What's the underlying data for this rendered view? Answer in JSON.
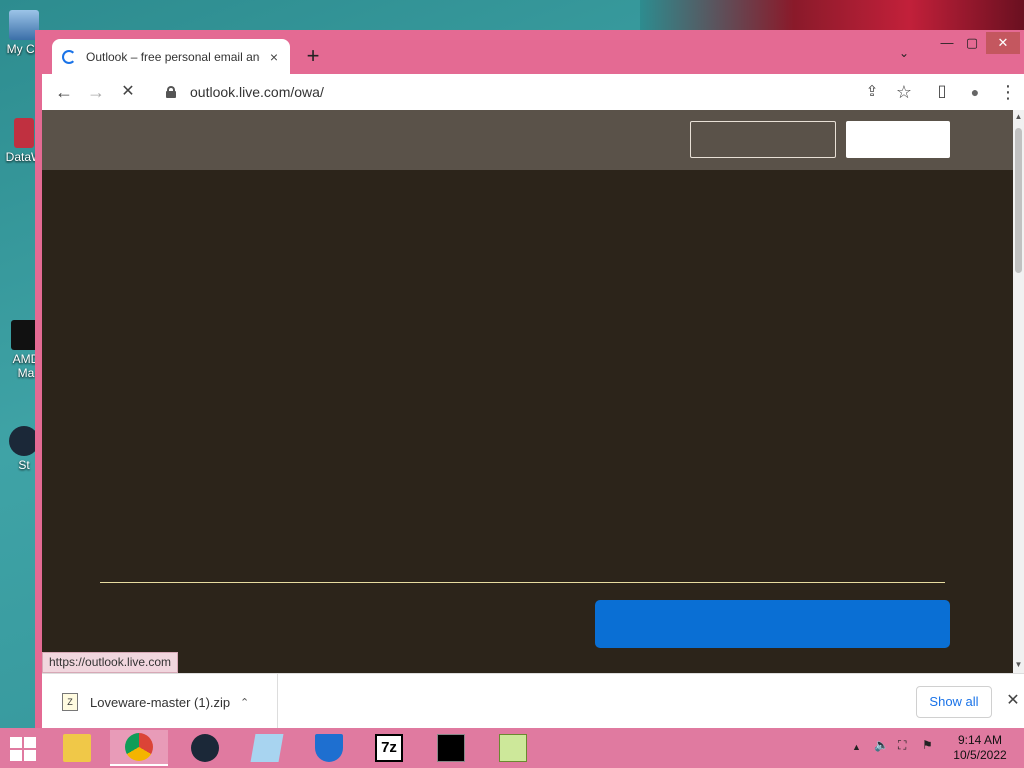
{
  "desktop": {
    "icons": [
      {
        "label": "My Co"
      },
      {
        "label": "DataW"
      },
      {
        "label": "AMD"
      },
      {
        "label": "Ma"
      },
      {
        "label": "St"
      }
    ]
  },
  "browser": {
    "tab": {
      "title": "Outlook – free personal email and",
      "close_icon": "×"
    },
    "new_tab": "+",
    "tab_menu": "⌄",
    "window_controls": {
      "minimize": "—",
      "maximize": "▢",
      "close": "✕"
    },
    "nav": {
      "back": "←",
      "forward": "→",
      "stop": "✕"
    },
    "address": {
      "url": "outlook.live.com/owa/"
    },
    "actions": {
      "share": "⇪",
      "bookmark": "☆",
      "side_panel": "▯",
      "profile": "●",
      "menu": "⋮"
    },
    "status_url": "https://outlook.live.com"
  },
  "downloads": {
    "file_name": "Loveware-master (1).zip",
    "file_icon": "Z",
    "chevron": "⌃",
    "show_all": "Show all",
    "close": "✕"
  },
  "taskbar": {
    "tray_chevron": "▲",
    "clock": {
      "time": "9:14 AM",
      "date": "10/5/2022"
    }
  },
  "colors": {
    "window_frame": "#e46a93",
    "page_header": "#5a5249",
    "page_body": "#2c241a",
    "primary_button": "#0a6fd4",
    "divider": "#e8dca0",
    "link_blue": "#1a73e8"
  }
}
